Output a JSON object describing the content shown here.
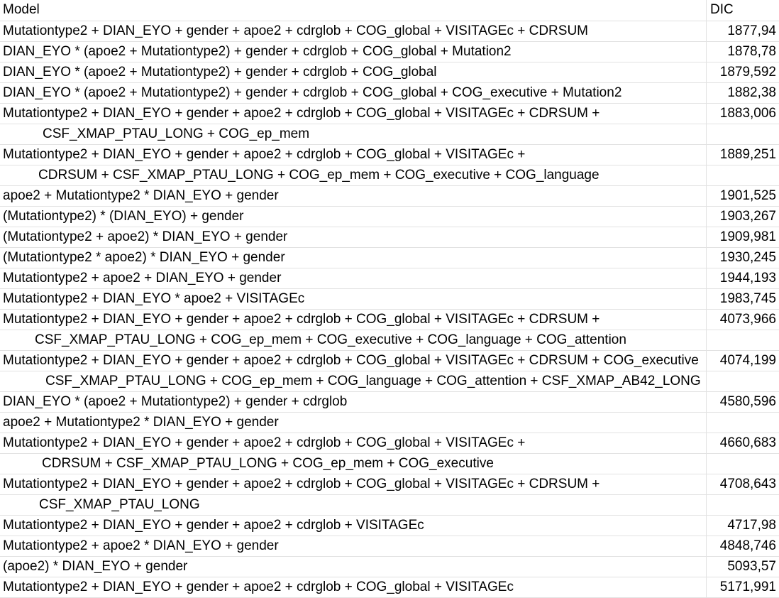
{
  "header": {
    "model": "Model",
    "dic": "DIC"
  },
  "rows": [
    {
      "model": "Mutationtype2 + DIAN_EYO + gender + apoe2 + cdrglob + COG_global + VISITAGEc + CDRSUM",
      "dic": "1877,94"
    },
    {
      "model": "DIAN_EYO * (apoe2 + Mutationtype2) + gender + cdrglob + COG_global + Mutation2",
      "dic": "1878,78"
    },
    {
      "model": "DIAN_EYO * (apoe2 + Mutationtype2) + gender + cdrglob + COG_global",
      "dic": "1879,592"
    },
    {
      "model": "DIAN_EYO * (apoe2 + Mutationtype2) + gender + cdrglob + COG_global + COG_executive + Mutation2",
      "dic": "1882,38"
    },
    {
      "model": "Mutationtype2 + DIAN_EYO + gender + apoe2 + cdrglob + COG_global + VISITAGEc + CDRSUM +",
      "dic": "1883,006"
    },
    {
      "model": "CSF_XMAP_PTAU_LONG +  COG_ep_mem",
      "dic": "",
      "indent": "ind1"
    },
    {
      "model": "Mutationtype2 + DIAN_EYO + gender + apoe2 + cdrglob + COG_global + VISITAGEc +",
      "dic": "1889,251"
    },
    {
      "model": "CDRSUM + CSF_XMAP_PTAU_LONG + COG_ep_mem + COG_executive + COG_language",
      "dic": "",
      "indent": "ind2"
    },
    {
      "model": "apoe2 + Mutationtype2 * DIAN_EYO + gender",
      "dic": "1901,525"
    },
    {
      "model": "(Mutationtype2) * (DIAN_EYO) + gender",
      "dic": "1903,267"
    },
    {
      "model": "(Mutationtype2 + apoe2) * DIAN_EYO + gender",
      "dic": "1909,981"
    },
    {
      "model": "(Mutationtype2 * apoe2) * DIAN_EYO + gender",
      "dic": "1930,245"
    },
    {
      "model": "Mutationtype2 + apoe2 + DIAN_EYO + gender",
      "dic": "1944,193"
    },
    {
      "model": "Mutationtype2 + DIAN_EYO * apoe2 + VISITAGEc",
      "dic": "1983,745"
    },
    {
      "model": "Mutationtype2 + DIAN_EYO + gender + apoe2 + cdrglob + COG_global + VISITAGEc + CDRSUM +",
      "dic": "4073,966"
    },
    {
      "model": "CSF_XMAP_PTAU_LONG + COG_ep_mem + COG_executive + COG_language + COG_attention",
      "dic": "",
      "indent": "ind3"
    },
    {
      "model": "Mutationtype2 + DIAN_EYO + gender + apoe2 + cdrglob + COG_global + VISITAGEc + CDRSUM + COG_executive",
      "dic": "4074,199"
    },
    {
      "model": "CSF_XMAP_PTAU_LONG + COG_ep_mem + COG_language + COG_attention + CSF_XMAP_AB42_LONG",
      "dic": "",
      "indent": "ind4"
    },
    {
      "model": "DIAN_EYO * (apoe2 + Mutationtype2) + gender + cdrglob",
      "dic": "4580,596"
    },
    {
      "model": "apoe2 + Mutationtype2 * DIAN_EYO + gender",
      "dic": ""
    },
    {
      "model": "Mutationtype2 + DIAN_EYO + gender + apoe2 + cdrglob + COG_global + VISITAGEc +",
      "dic": "4660,683"
    },
    {
      "model": "CDRSUM + CSF_XMAP_PTAU_LONG + COG_ep_mem + COG_executive",
      "dic": "",
      "indent": "ind5"
    },
    {
      "model": "Mutationtype2 + DIAN_EYO + gender + apoe2 + cdrglob + COG_global + VISITAGEc + CDRSUM +",
      "dic": "4708,643"
    },
    {
      "model": "CSF_XMAP_PTAU_LONG",
      "dic": "",
      "indent": "ind6"
    },
    {
      "model": "Mutationtype2 + DIAN_EYO + gender + apoe2 + cdrglob + VISITAGEc",
      "dic": "4717,98"
    },
    {
      "model": "Mutationtype2 + apoe2 * DIAN_EYO + gender",
      "dic": "4848,746"
    },
    {
      "model": "(apoe2) * DIAN_EYO + gender",
      "dic": "5093,57"
    },
    {
      "model": "Mutationtype2 + DIAN_EYO + gender + apoe2 + cdrglob + COG_global + VISITAGEc",
      "dic": "5171,991"
    }
  ]
}
